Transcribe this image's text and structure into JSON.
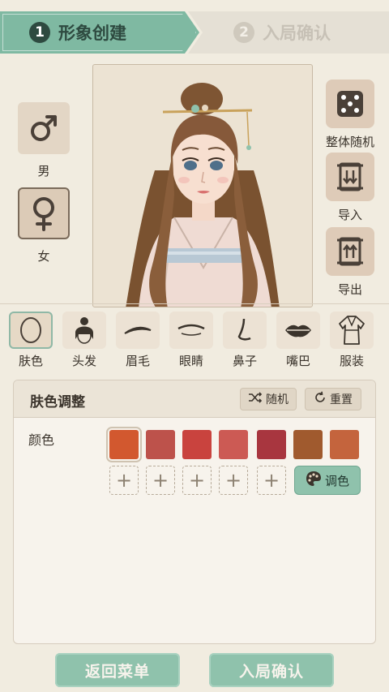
{
  "steps": [
    {
      "num": "1",
      "label": "形象创建",
      "active": true
    },
    {
      "num": "2",
      "label": "入局确认",
      "active": false
    }
  ],
  "gender": {
    "male": {
      "icon": "male-symbol-icon",
      "label": "男"
    },
    "female": {
      "icon": "female-symbol-icon",
      "label": "女"
    },
    "selected": "female"
  },
  "actions": {
    "random_all": {
      "icon": "dice-icon",
      "label": "整体随机"
    },
    "import": {
      "icon": "import-scroll-icon",
      "label": "导入"
    },
    "export": {
      "icon": "export-scroll-icon",
      "label": "导出"
    }
  },
  "tabs": [
    {
      "label": "肤色",
      "icon": "face-outline-icon"
    },
    {
      "label": "头发",
      "icon": "hair-bun-icon"
    },
    {
      "label": "眉毛",
      "icon": "eyebrow-icon"
    },
    {
      "label": "眼睛",
      "icon": "eye-icon"
    },
    {
      "label": "鼻子",
      "icon": "nose-icon"
    },
    {
      "label": "嘴巴",
      "icon": "lips-icon"
    },
    {
      "label": "服装",
      "icon": "robe-icon"
    }
  ],
  "selected_tab": "肤色",
  "panel": {
    "title": "肤色调整",
    "random_label": "随机",
    "reset_label": "重置",
    "color_label": "颜色",
    "mix_label": "调色",
    "add_symbol": "+",
    "swatches": [
      "#d2582f",
      "#bd524b",
      "#c9433e",
      "#cc5a54",
      "#a8363f",
      "#a05a2e",
      "#c4643d"
    ],
    "selected_swatch": 0,
    "empty_slots": 5
  },
  "buttons": {
    "back": "返回菜单",
    "confirm": "入局确认"
  },
  "colors": {
    "accent": "#8fc2ac",
    "step_active": "#7fb9a2",
    "background": "#f1ece0"
  }
}
